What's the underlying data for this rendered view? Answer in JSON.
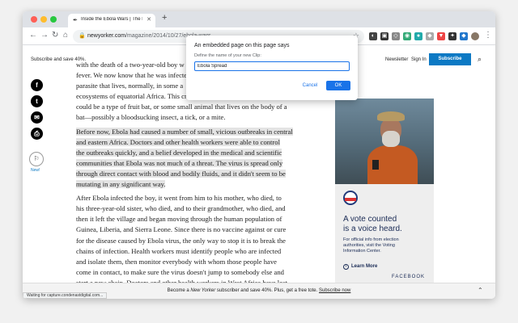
{
  "browser": {
    "tab_title": "Inside the Ebola Wars | The N",
    "tab_favicon": "The New Yorker favicon",
    "url_domain": "newyorker.com",
    "url_path": "/magazine/2014/10/27/ebola-wars",
    "status_text": "Waiting for capture.condenastdigital.com..."
  },
  "site": {
    "promo": "Subscribe and save 40%.",
    "newsletter": "Newsletter",
    "signin": "Sign In",
    "subscribe": "Subscribe"
  },
  "social": {
    "new_label": "New!"
  },
  "article": {
    "paragraphs": [
      {
        "lines": [
          "with the death of a two-year-old boy w",
          "fever. We now know that he was infecte",
          "parasite that lives, normally, in some a",
          "ecosystems of equatorial Africa. This creature is the natural host of Ebola; it",
          "could be a type of fruit bat, or some small animal that lives on the body of a",
          "bat—possibly a bloodsucking insect, a tick, or a mite."
        ]
      },
      {
        "lines": [
          "Before now, Ebola had caused a number of small, vicious outbreaks in central",
          "and eastern Africa. Doctors and other health workers were able to control",
          "the outbreaks quickly, and a belief developed in the medical and scientific",
          "communities that Ebola was not much of a threat. The virus is spread only",
          "through direct contact with blood and bodily fluids, and it didn't seem to be",
          "mutating in any significant way."
        ]
      },
      {
        "lines": [
          "After Ebola infected the boy, it went from him to his mother, who died, to",
          "his three-year-old sister, who died, and to their grandmother, who died, and",
          "then it left the village and began moving through the human population of",
          "Guinea, Liberia, and Sierra Leone. Since there is no vaccine against or cure",
          "for the disease caused by Ebola virus, the only way to stop it is to break the",
          "chains of infection. Health workers must identify people who are infected",
          "and isolate them, then monitor everybody with whom those people have",
          "come in contact, to make sure the virus doesn't jump to somebody else and",
          "start a new chain. Doctors and other health workers in West Africa have lost"
        ]
      }
    ]
  },
  "ad": {
    "headline_1": "A vote counted",
    "headline_2": "is a voice heard.",
    "body_1": "For official info from election",
    "body_2": "authorities, visit the Voting",
    "body_3": "Information Center.",
    "learn_more": "Learn More",
    "brand": "FACEBOOK"
  },
  "dialog": {
    "title": "An embedded page on this page says",
    "message": "Define the name of your new Clip:",
    "input_value": "Ebola Spread",
    "cancel": "Cancel",
    "ok": "OK"
  },
  "bottom_bar": {
    "text_before": "Become a ",
    "text_italic": "New Yorker",
    "text_after": " subscriber and save 40%. Plus, get a free tote. ",
    "link": "Subscribe now"
  }
}
